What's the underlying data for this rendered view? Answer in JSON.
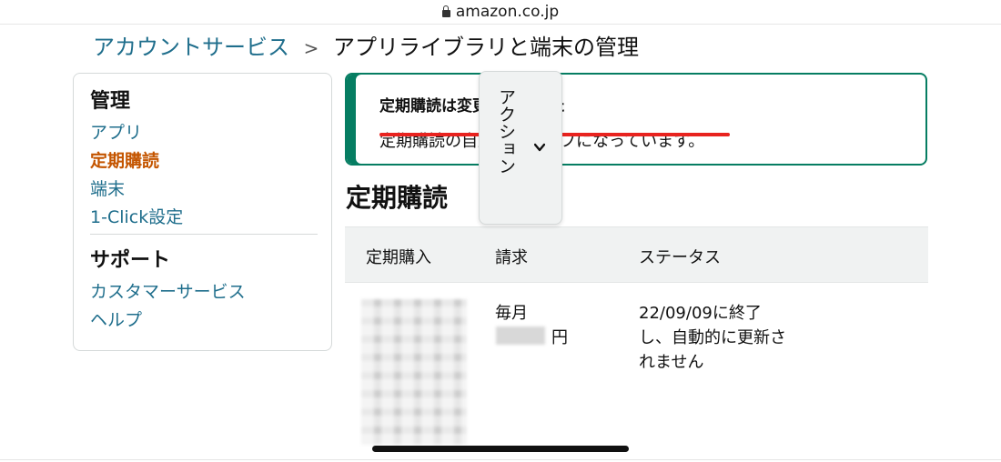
{
  "browser": {
    "url": "amazon.co.jp"
  },
  "breadcrumb": {
    "parent": "アカウントサービス",
    "separator": ">",
    "current": "アプリライブラリと端末の管理"
  },
  "sidebar": {
    "manage_title": "管理",
    "manage_items": [
      {
        "label": "アプリ"
      },
      {
        "label": "定期購読"
      },
      {
        "label": "端末"
      },
      {
        "label": "1-Click設定"
      }
    ],
    "support_title": "サポート",
    "support_items": [
      {
        "label": "カスタマーサービス"
      },
      {
        "label": "ヘルプ"
      }
    ]
  },
  "alert": {
    "title": "定期購読は変更されました",
    "message": "定期購読の自動更新はオフになっています。"
  },
  "section": {
    "title": "定期購読"
  },
  "table": {
    "headers": {
      "item": "定期購入",
      "billing": "請求",
      "status": "ステータス"
    },
    "row": {
      "billing_period": "毎月",
      "billing_currency": "円",
      "status": "22/09/09に終了し、自動的に更新されません",
      "action_label": "アクション"
    }
  },
  "colors": {
    "link": "#1f6e8c",
    "active": "#c45500",
    "alert_border": "#067d62",
    "annotation": "#e8231f"
  }
}
